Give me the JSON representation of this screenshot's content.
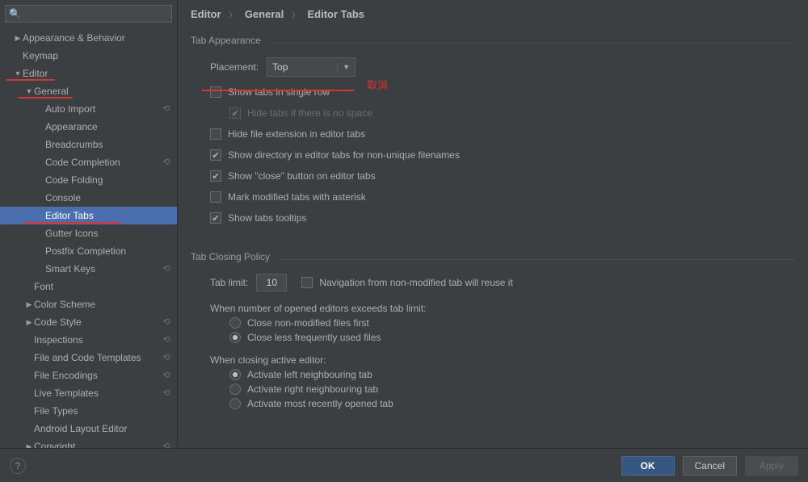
{
  "search": {
    "value": ""
  },
  "sidebar": {
    "items": [
      {
        "label": "Appearance & Behavior",
        "caret": "▶",
        "indent": 1
      },
      {
        "label": "Keymap",
        "caret": "",
        "indent": 1
      },
      {
        "label": "Editor",
        "caret": "▼",
        "indent": 1
      },
      {
        "label": "General",
        "caret": "▼",
        "indent": 2
      },
      {
        "label": "Auto Import",
        "caret": "",
        "indent": 3,
        "reset": true
      },
      {
        "label": "Appearance",
        "caret": "",
        "indent": 3
      },
      {
        "label": "Breadcrumbs",
        "caret": "",
        "indent": 3
      },
      {
        "label": "Code Completion",
        "caret": "",
        "indent": 3,
        "reset": true
      },
      {
        "label": "Code Folding",
        "caret": "",
        "indent": 3
      },
      {
        "label": "Console",
        "caret": "",
        "indent": 3
      },
      {
        "label": "Editor Tabs",
        "caret": "",
        "indent": 3,
        "selected": true
      },
      {
        "label": "Gutter Icons",
        "caret": "",
        "indent": 3
      },
      {
        "label": "Postfix Completion",
        "caret": "",
        "indent": 3
      },
      {
        "label": "Smart Keys",
        "caret": "",
        "indent": 3,
        "reset": true
      },
      {
        "label": "Font",
        "caret": "",
        "indent": 2
      },
      {
        "label": "Color Scheme",
        "caret": "▶",
        "indent": 2
      },
      {
        "label": "Code Style",
        "caret": "▶",
        "indent": 2,
        "reset": true
      },
      {
        "label": "Inspections",
        "caret": "",
        "indent": 2,
        "reset": true
      },
      {
        "label": "File and Code Templates",
        "caret": "",
        "indent": 2,
        "reset": true
      },
      {
        "label": "File Encodings",
        "caret": "",
        "indent": 2,
        "reset": true
      },
      {
        "label": "Live Templates",
        "caret": "",
        "indent": 2,
        "reset": true
      },
      {
        "label": "File Types",
        "caret": "",
        "indent": 2
      },
      {
        "label": "Android Layout Editor",
        "caret": "",
        "indent": 2
      },
      {
        "label": "Copyright",
        "caret": "▶",
        "indent": 2,
        "reset": true
      }
    ]
  },
  "breadcrumb": {
    "a": "Editor",
    "b": "General",
    "c": "Editor Tabs"
  },
  "tabAppearance": {
    "title": "Tab Appearance",
    "placement_label": "Placement:",
    "placement_value": "Top",
    "show_single_row": "Show tabs in single row",
    "hide_if_no_space": "Hide tabs if there is no space",
    "hide_ext": "Hide file extension in editor tabs",
    "show_dir": "Show directory in editor tabs for non-unique filenames",
    "show_close": "Show \"close\" button on editor tabs",
    "mark_asterisk": "Mark modified tabs with asterisk",
    "show_tooltips": "Show tabs tooltips"
  },
  "tabClosing": {
    "title": "Tab Closing Policy",
    "tab_limit_label": "Tab limit:",
    "tab_limit_value": "10",
    "nav_reuse": "Navigation from non-modified tab will reuse it",
    "exceed_label": "When number of opened editors exceeds tab limit:",
    "close_nonmod": "Close non-modified files first",
    "close_lfu": "Close less frequently used files",
    "closing_label": "When closing active editor:",
    "act_left": "Activate left neighbouring tab",
    "act_right": "Activate right neighbouring tab",
    "act_recent": "Activate most recently opened tab"
  },
  "annotation": "取消",
  "footer": {
    "ok": "OK",
    "cancel": "Cancel",
    "apply": "Apply"
  }
}
